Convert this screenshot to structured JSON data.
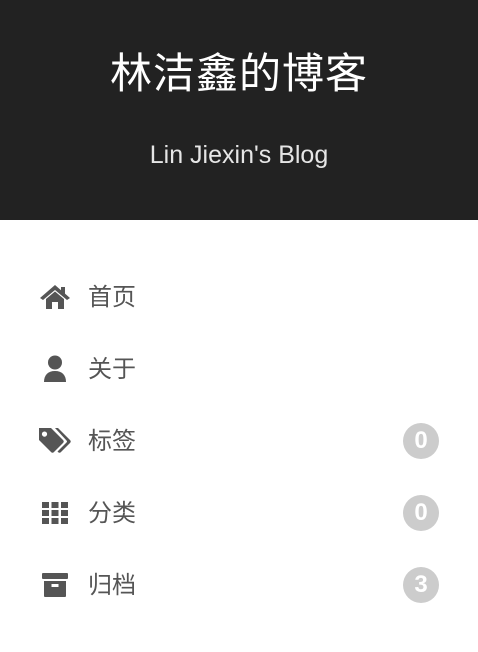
{
  "header": {
    "title": "林洁鑫的博客",
    "subtitle": "Lin Jiexin's Blog",
    "background": "#222222"
  },
  "menu": {
    "items": [
      {
        "label": "首页",
        "icon": "home-icon"
      },
      {
        "label": "关于",
        "icon": "user-icon"
      },
      {
        "label": "标签",
        "icon": "tags-icon",
        "count": "0"
      },
      {
        "label": "分类",
        "icon": "grid-icon",
        "count": "0"
      },
      {
        "label": "归档",
        "icon": "archive-icon",
        "count": "3"
      }
    ],
    "text_color": "#555555",
    "badge_color": "#cccccc"
  }
}
